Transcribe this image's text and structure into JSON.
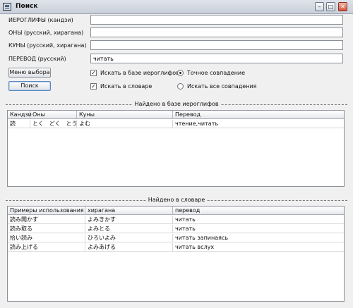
{
  "window": {
    "title": "Поиск",
    "min": "–",
    "max": "□",
    "close": "✕"
  },
  "form": {
    "kanji_label": "ИЕРОГЛИФЫ (кандзи)",
    "on_label": "ОНЫ  (русский, хирагана)",
    "kun_label": "КУНЫ (русский, хирагана)",
    "translation_label": "ПЕРЕВОД (русский)",
    "kanji_value": "",
    "on_value": "",
    "kun_value": "",
    "translation_value": "читать"
  },
  "buttons": {
    "menu": "Меню выбора",
    "search": "Поиск"
  },
  "options": {
    "search_kanji": "Искать в базе иероглифов",
    "search_dict": "Искать в словаре",
    "exact_match": "Точное совпадение",
    "all_matches": "Искать все совпадения",
    "search_kanji_checked": true,
    "search_dict_checked": true,
    "exact_selected": true
  },
  "kanji_section": {
    "title": "Найдено в базе иероглифов",
    "headers": [
      "Кандзи",
      "Оны",
      "Куны",
      "Перевод"
    ],
    "rows": [
      [
        "読",
        "とく　どく　とう",
        "よむ",
        "чтение,читать"
      ]
    ]
  },
  "dict_section": {
    "title": "Найдено в словаре",
    "headers": [
      "Примеры использования",
      "хирагана",
      "перевод"
    ],
    "rows": [
      [
        "読み聞かす",
        "よみきかす",
        "читать"
      ],
      [
        "読み取る",
        "よみとる",
        "читать"
      ],
      [
        "拾い読み",
        "ひろいよみ",
        "читать запинаясь"
      ],
      [
        "読み上げる",
        "よみあげる",
        "читать вслух"
      ]
    ]
  }
}
